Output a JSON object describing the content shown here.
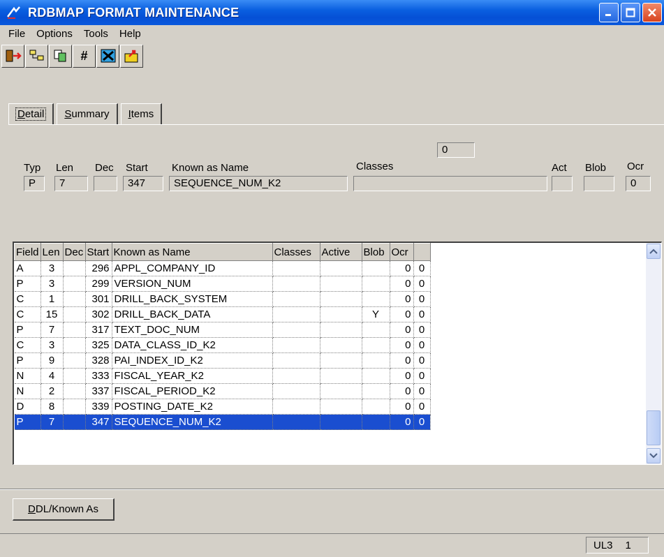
{
  "window": {
    "title": "RDBMAP FORMAT MAINTENANCE"
  },
  "menu": [
    "File",
    "Options",
    "Tools",
    "Help"
  ],
  "toolbar": {
    "icons": [
      "exit-icon",
      "tree-icon",
      "copy-icon",
      "hash-icon",
      "tools-icon",
      "open-icon"
    ],
    "hash_label": "#"
  },
  "tabs": [
    {
      "pre": "",
      "ul": "D",
      "post": "etail"
    },
    {
      "pre": "",
      "ul": "S",
      "post": "ummary"
    },
    {
      "pre": "",
      "ul": "I",
      "post": "tems"
    }
  ],
  "detail": {
    "labels": {
      "typ": "Typ",
      "len": "Len",
      "dec": "Dec",
      "start": "Start",
      "known_as": "Known as Name",
      "classes": "Classes",
      "act": "Act",
      "blob": "Blob",
      "ocr": "Ocr"
    },
    "values": {
      "classes_count": "0",
      "typ": "P",
      "len": "7",
      "dec": "",
      "start": "347",
      "known_as": "SEQUENCE_NUM_K2",
      "classes": "",
      "act": "",
      "blob": "",
      "ocr": "0"
    }
  },
  "grid": {
    "columns": [
      "Field",
      "Len",
      "Dec",
      "Start",
      "Known as Name",
      "Classes",
      "Active",
      "Blob",
      "Ocr",
      ""
    ],
    "rows": [
      [
        "A",
        "3",
        "",
        "296",
        "APPL_COMPANY_ID",
        "",
        "",
        "",
        "0",
        "0"
      ],
      [
        "P",
        "3",
        "",
        "299",
        "VERSION_NUM",
        "",
        "",
        "",
        "0",
        "0"
      ],
      [
        "C",
        "1",
        "",
        "301",
        "DRILL_BACK_SYSTEM",
        "",
        "",
        "",
        "0",
        "0"
      ],
      [
        "C",
        "15",
        "",
        "302",
        "DRILL_BACK_DATA",
        "",
        "",
        "Y",
        "0",
        "0"
      ],
      [
        "P",
        "7",
        "",
        "317",
        "TEXT_DOC_NUM",
        "",
        "",
        "",
        "0",
        "0"
      ],
      [
        "C",
        "3",
        "",
        "325",
        "DATA_CLASS_ID_K2",
        "",
        "",
        "",
        "0",
        "0"
      ],
      [
        "P",
        "9",
        "",
        "328",
        "PAI_INDEX_ID_K2",
        "",
        "",
        "",
        "0",
        "0"
      ],
      [
        "N",
        "4",
        "",
        "333",
        "FISCAL_YEAR_K2",
        "",
        "",
        "",
        "0",
        "0"
      ],
      [
        "N",
        "2",
        "",
        "337",
        "FISCAL_PERIOD_K2",
        "",
        "",
        "",
        "0",
        "0"
      ],
      [
        "D",
        "8",
        "",
        "339",
        "POSTING_DATE_K2",
        "",
        "",
        "",
        "0",
        "0"
      ],
      [
        "P",
        "7",
        "",
        "347",
        "SEQUENCE_NUM_K2",
        "",
        "",
        "",
        "0",
        "0"
      ]
    ],
    "selected_row": 10
  },
  "buttons": {
    "ddl": {
      "ul": "D",
      "post": "DL/Known As"
    }
  },
  "status": {
    "user": "UL3",
    "page": "1"
  }
}
